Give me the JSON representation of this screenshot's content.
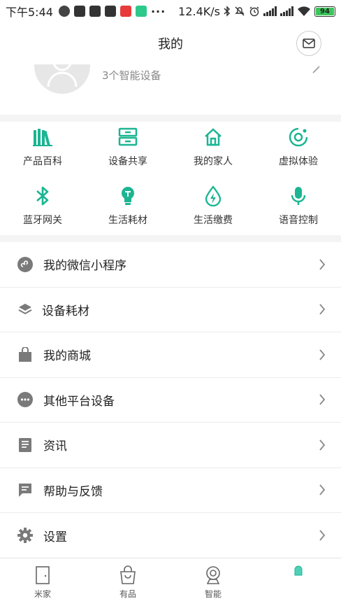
{
  "status_bar": {
    "time": "下午5:44",
    "net_speed": "12.4K/s",
    "battery": "94"
  },
  "header": {
    "title": "我的"
  },
  "profile": {
    "device_count": "3个智能设备"
  },
  "colors": {
    "accent": "#1bb592",
    "menu_icon": "#7a7a7a",
    "divider": "#f4f4f4"
  },
  "grid": {
    "items": [
      {
        "label": "产品百科",
        "icon": "books-icon"
      },
      {
        "label": "设备共享",
        "icon": "cabinet-icon"
      },
      {
        "label": "我的家人",
        "icon": "home-icon"
      },
      {
        "label": "虚拟体验",
        "icon": "target-icon"
      },
      {
        "label": "蓝牙网关",
        "icon": "bluetooth-icon"
      },
      {
        "label": "生活耗材",
        "icon": "bulb-icon"
      },
      {
        "label": "生活缴费",
        "icon": "drop-bolt-icon"
      },
      {
        "label": "语音控制",
        "icon": "microphone-icon"
      }
    ]
  },
  "menu": {
    "items": [
      {
        "label": "我的微信小程序",
        "icon": "mini-program-icon"
      },
      {
        "label": "设备耗材",
        "icon": "layers-icon"
      },
      {
        "label": "我的商城",
        "icon": "shopping-bag-icon"
      },
      {
        "label": "其他平台设备",
        "icon": "more-dots-icon"
      },
      {
        "label": "资讯",
        "icon": "news-icon"
      },
      {
        "label": "帮助与反馈",
        "icon": "feedback-icon"
      },
      {
        "label": "设置",
        "icon": "gear-icon"
      }
    ]
  },
  "bottom_nav": {
    "items": [
      {
        "label": "米家",
        "icon": "door-icon"
      },
      {
        "label": "有品",
        "icon": "bag-icon"
      },
      {
        "label": "智能",
        "icon": "camera-icon"
      },
      {
        "label": "",
        "icon": "profile-active-icon"
      }
    ]
  }
}
